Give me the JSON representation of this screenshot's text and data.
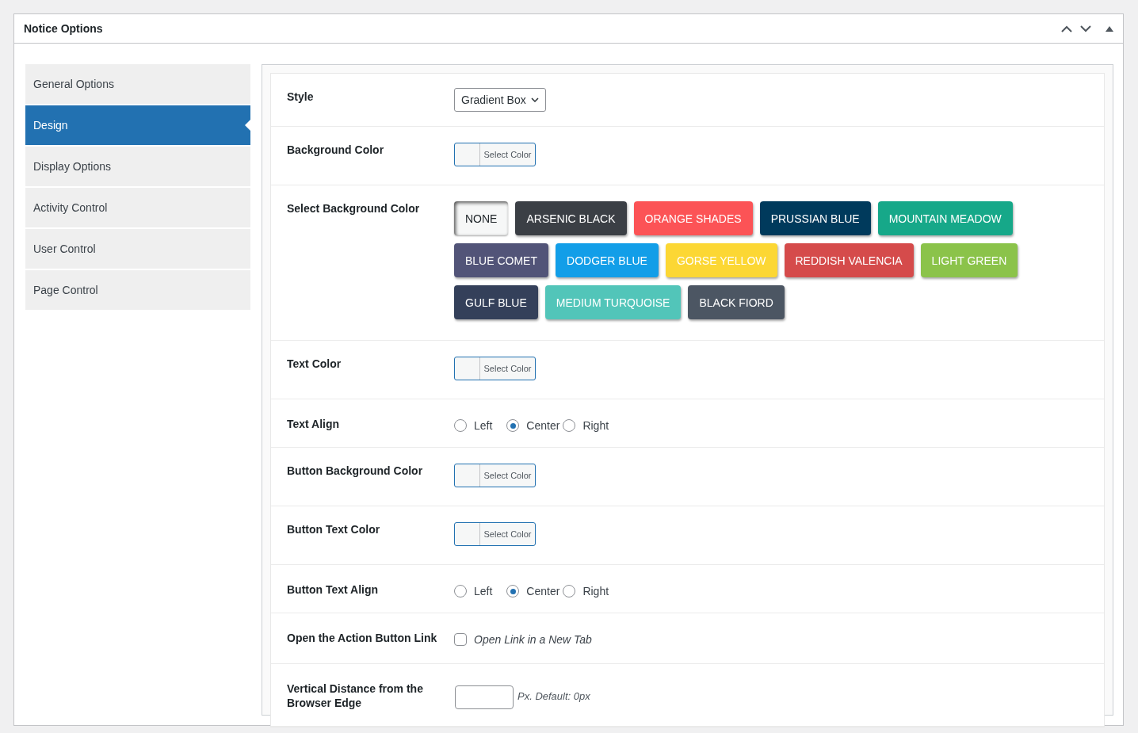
{
  "panel": {
    "title": "Notice Options"
  },
  "sidebar": {
    "items": [
      {
        "label": "General Options",
        "selected": false
      },
      {
        "label": "Design",
        "selected": true
      },
      {
        "label": "Display Options",
        "selected": false
      },
      {
        "label": "Activity Control",
        "selected": false
      },
      {
        "label": "User Control",
        "selected": false
      },
      {
        "label": "Page Control",
        "selected": false
      }
    ]
  },
  "settings": [
    {
      "kind": "select",
      "label": "Style",
      "value": "Gradient Box"
    },
    {
      "kind": "color",
      "label": "Background Color",
      "button": "Select Color"
    },
    {
      "kind": "swatches",
      "label": "Select Background Color",
      "swatches": [
        {
          "label": "NONE",
          "color": "#f6f7f7",
          "selected": true
        },
        {
          "label": "ARSENIC BLACK",
          "color": "#3b3f45",
          "selected": false
        },
        {
          "label": "ORANGE SHADES",
          "color": "#fc5356",
          "selected": false
        },
        {
          "label": "PRUSSIAN BLUE",
          "color": "#003a5c",
          "selected": false
        },
        {
          "label": "MOUNTAIN MEADOW",
          "color": "#16a889",
          "selected": false
        },
        {
          "label": "BLUE COMET",
          "color": "#525478",
          "selected": false
        },
        {
          "label": "DODGER BLUE",
          "color": "#129ee8",
          "selected": false
        },
        {
          "label": "GORSE YELLOW",
          "color": "#fcd734",
          "selected": false
        },
        {
          "label": "REDDISH VALENCIA",
          "color": "#d54b4b",
          "selected": false
        },
        {
          "label": "LIGHT GREEN",
          "color": "#8bc34a",
          "selected": false
        },
        {
          "label": "GULF BLUE",
          "color": "#34405a",
          "selected": false
        },
        {
          "label": "MEDIUM TURQUOISE",
          "color": "#52c5b9",
          "selected": false
        },
        {
          "label": "BLACK FIORD",
          "color": "#4c5663",
          "selected": false
        }
      ]
    },
    {
      "kind": "color",
      "label": "Text Color",
      "button": "Select Color"
    },
    {
      "kind": "radio",
      "label": "Text Align",
      "options": [
        {
          "label": "Left",
          "selected": false
        },
        {
          "label": "Center",
          "selected": true
        },
        {
          "label": "Right",
          "selected": false
        }
      ]
    },
    {
      "kind": "color",
      "label": "Button Background Color",
      "button": "Select Color"
    },
    {
      "kind": "color",
      "label": "Button Text Color",
      "button": "Select Color"
    },
    {
      "kind": "radio",
      "label": "Button Text Align",
      "options": [
        {
          "label": "Left",
          "selected": false
        },
        {
          "label": "Center",
          "selected": true
        },
        {
          "label": "Right",
          "selected": false
        }
      ]
    },
    {
      "kind": "checkbox",
      "label": "Open the Action Button Link",
      "text": "Open Link in a New Tab",
      "checked": false
    },
    {
      "kind": "number",
      "label": "Vertical Distance from the Browser Edge",
      "hint": "Px. Default: 0px"
    }
  ]
}
